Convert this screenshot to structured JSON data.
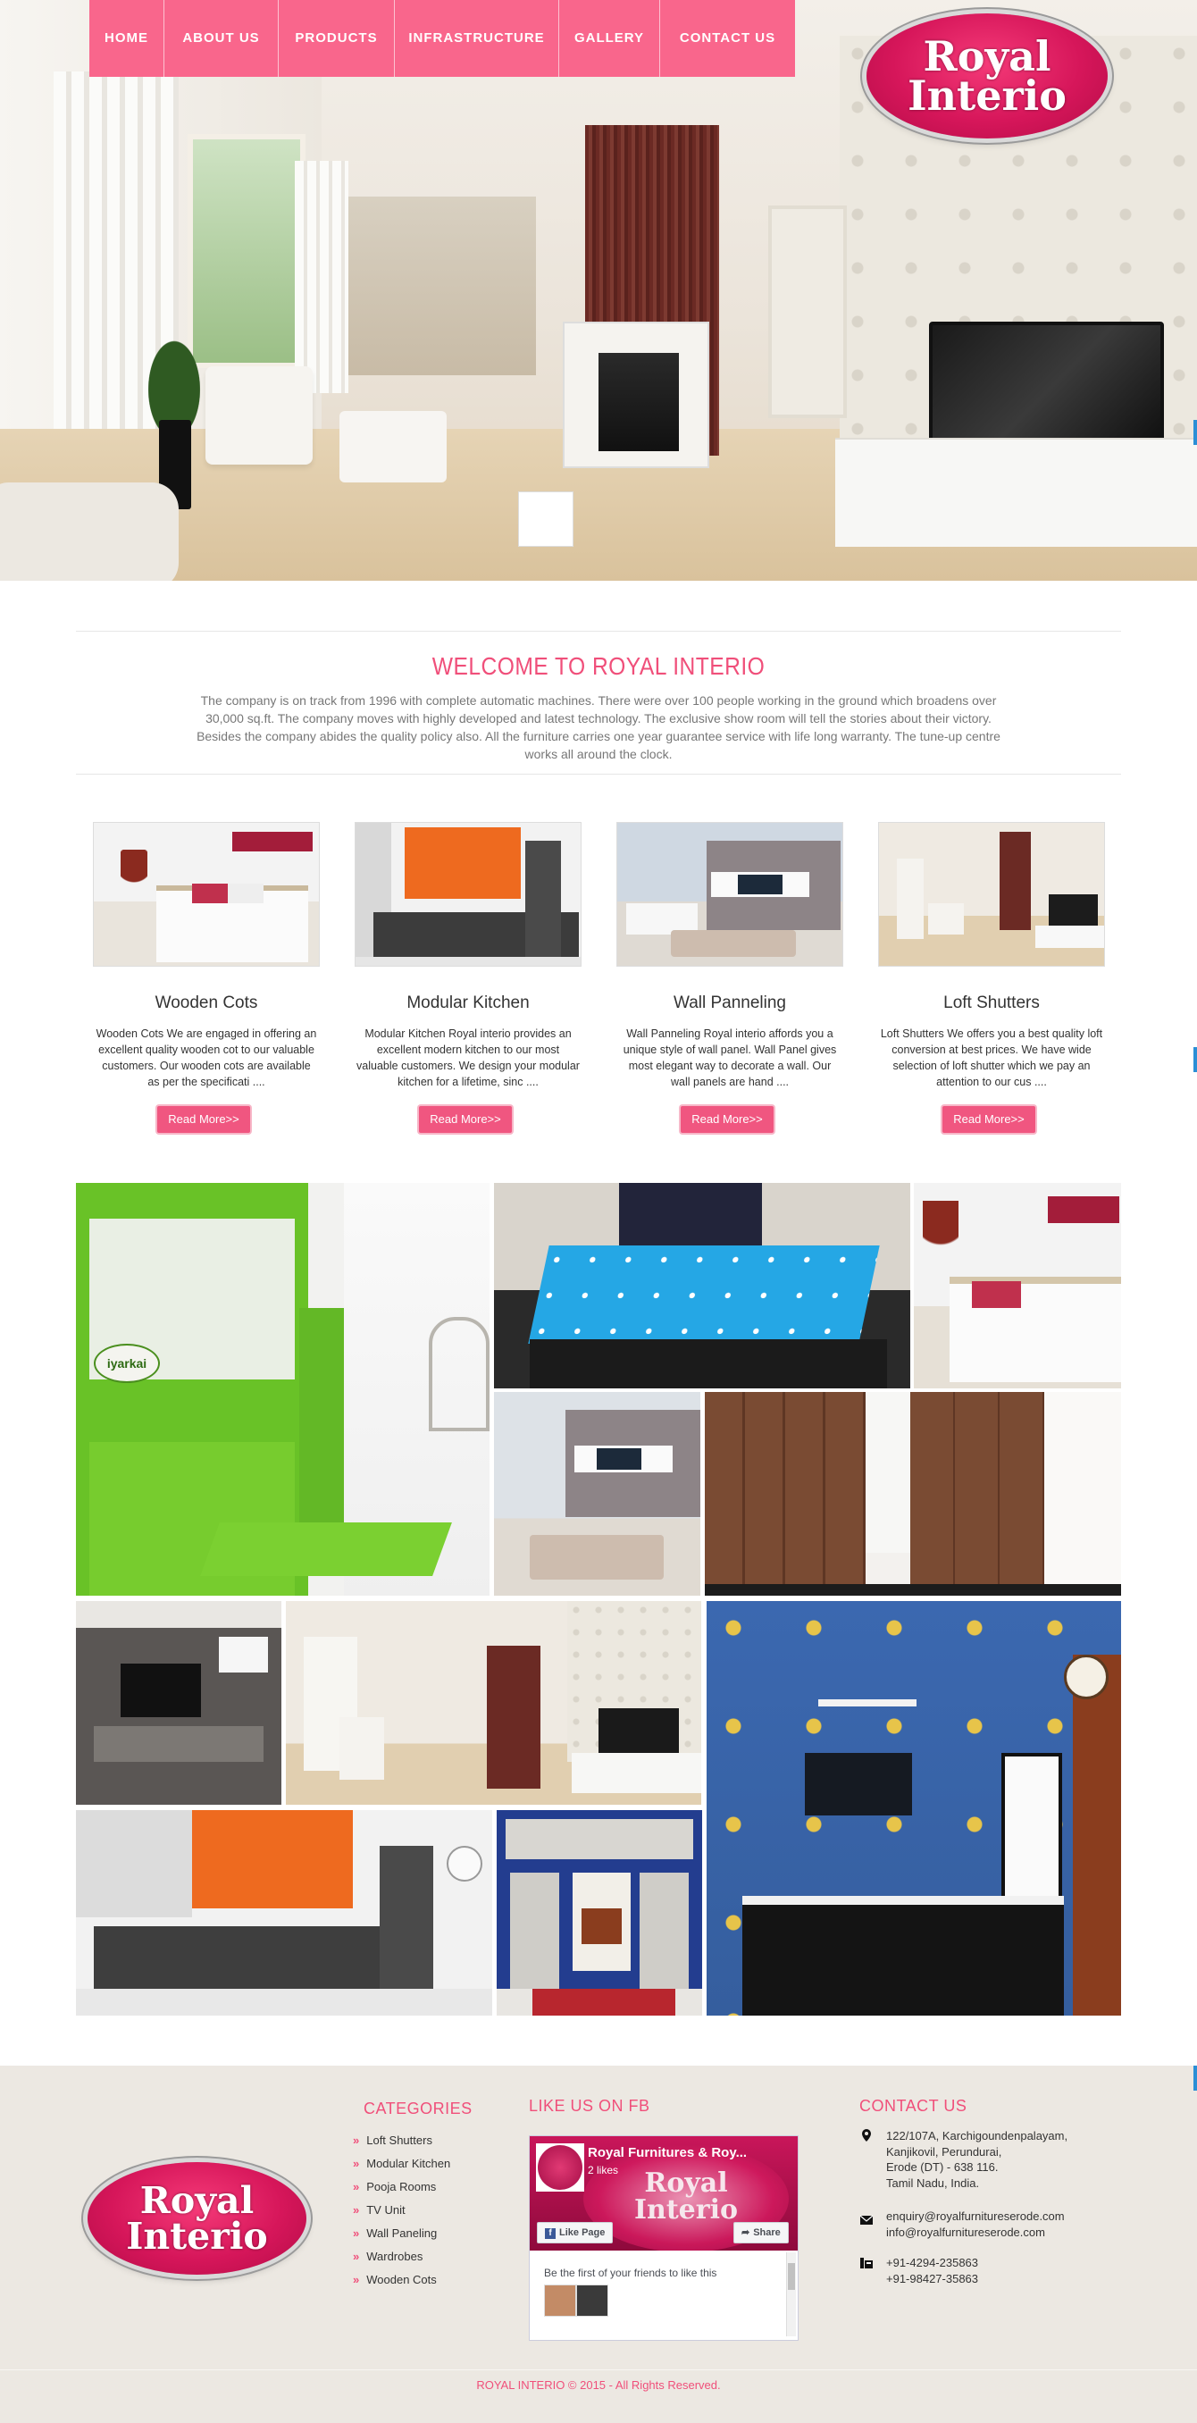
{
  "colors": {
    "accent": "#f9668c",
    "title_pink": "#f04f7a",
    "footer_bg": "#ece8e2"
  },
  "nav": {
    "items": [
      "HOME",
      "ABOUT US",
      "PRODUCTS",
      "INFRASTRUCTURE",
      "GALLERY",
      "CONTACT US"
    ]
  },
  "logo": {
    "line1": "Royal",
    "line2": "Interio"
  },
  "welcome": {
    "title": "WELCOME TO ROYAL INTERIO",
    "text": "The company is on track from 1996 with complete automatic machines. There were over 100 people working in the ground which broadens over 30,000 sq.ft. The company moves with highly developed and latest technology. The exclusive show room will tell the stories about their victory. Besides the company abides the quality policy also. All the furniture carries one year guarantee service with life long warranty. The tune-up centre works all around the clock."
  },
  "products": [
    {
      "title": "Wooden Cots",
      "text": "Wooden Cots We are engaged in offering an excellent quality wooden cot to our valuable customers. Our wooden cots are available as per the specificati ....",
      "button": "Read More>>"
    },
    {
      "title": "Modular Kitchen",
      "text": "Modular Kitchen Royal interio provides an excellent modern kitchen to our most valuable customers. We design your modular kitchen for a lifetime, sinc ....",
      "button": "Read More>>"
    },
    {
      "title": "Wall Panneling",
      "text": "Wall Panneling Royal interio affords you a unique style of wall panel. Wall Panel gives most elegant way to decorate a wall. Our wall panels are hand  ....",
      "button": "Read More>>"
    },
    {
      "title": "Loft Shutters",
      "text": "Loft Shutters We offers you a best quality loft conversion at best prices. We have wide selection of loft shutter which we pay an attention to our cus ....",
      "button": "Read More>>"
    }
  ],
  "gallery": {
    "sign_text": "iyarkai"
  },
  "footer": {
    "categories_title": "CATEGORIES",
    "categories": [
      "Loft Shutters",
      "Modular Kitchen",
      "Pooja Rooms",
      "TV Unit",
      "Wall Paneling",
      "Wardrobes",
      "Wooden Cots"
    ],
    "fb_title": "LIKE US ON FB",
    "fb": {
      "page_name": "Royal Furnitures & Roy...",
      "likes": "2 likes",
      "like_button": "Like Page",
      "share_button": "Share",
      "friends_text": "Be the first of your friends to like this"
    },
    "contact_title": "CONTACT US",
    "address": [
      "122/107A, Karchigoundenpalayam,",
      "Kanjikovil, Perundurai,",
      "Erode (DT) - 638 116.",
      "Tamil Nadu, India."
    ],
    "emails": [
      "enquiry@royalfurnitureserode.com",
      "info@royalfurnitureserode.com"
    ],
    "phones": [
      "+91-4294-235863",
      "+91-98427-35863"
    ],
    "copyright": "ROYAL INTERIO © 2015 - All Rights Reserved."
  }
}
